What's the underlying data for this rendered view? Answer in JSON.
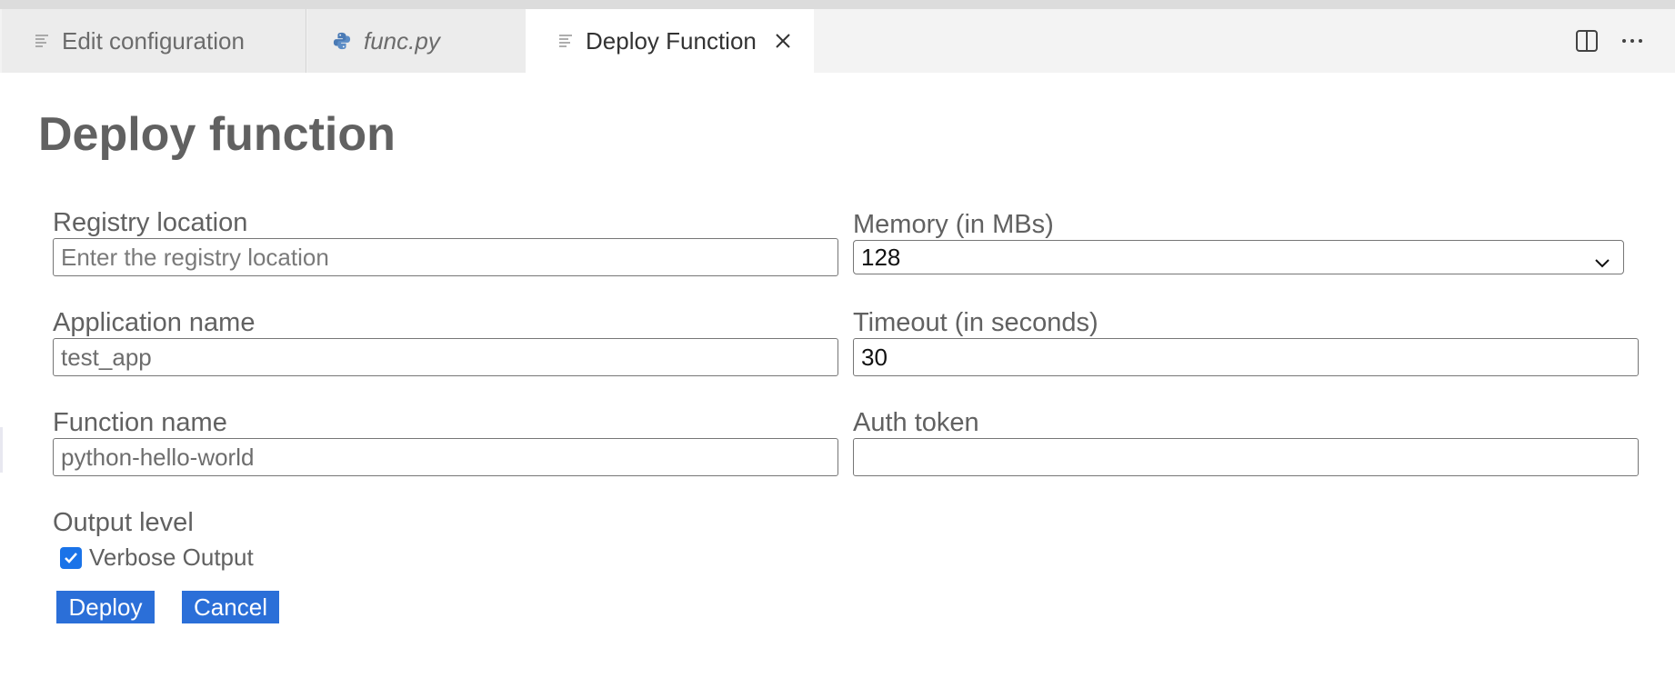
{
  "tabs": [
    {
      "label": "Edit configuration",
      "icon": "lines-icon",
      "active": false,
      "italic": false
    },
    {
      "label": "func.py",
      "icon": "python-icon",
      "active": false,
      "italic": true
    },
    {
      "label": "Deploy Function",
      "icon": "lines-icon",
      "active": true,
      "italic": false
    }
  ],
  "editor_actions": [
    "split-editor-icon",
    "more-actions-icon"
  ],
  "form": {
    "title": "Deploy function",
    "registry": {
      "label": "Registry location",
      "value": "",
      "placeholder": "Enter the registry location"
    },
    "memory": {
      "label": "Memory (in MBs)",
      "selected": "128"
    },
    "app_name": {
      "label": "Application name",
      "value": "test_app"
    },
    "timeout": {
      "label": "Timeout (in seconds)",
      "value": "30"
    },
    "function_name": {
      "label": "Function name",
      "value": "python-hello-world"
    },
    "auth_token": {
      "label": "Auth token",
      "value": ""
    },
    "output_level": {
      "label": "Output level",
      "checkbox_label": "Verbose Output",
      "checked": true
    },
    "buttons": {
      "deploy": "Deploy",
      "cancel": "Cancel"
    }
  },
  "colors": {
    "accent": "#2b6fd8",
    "checkbox": "#1a73e8",
    "tab_bar": "#f3f3f3",
    "text": "#616161"
  }
}
